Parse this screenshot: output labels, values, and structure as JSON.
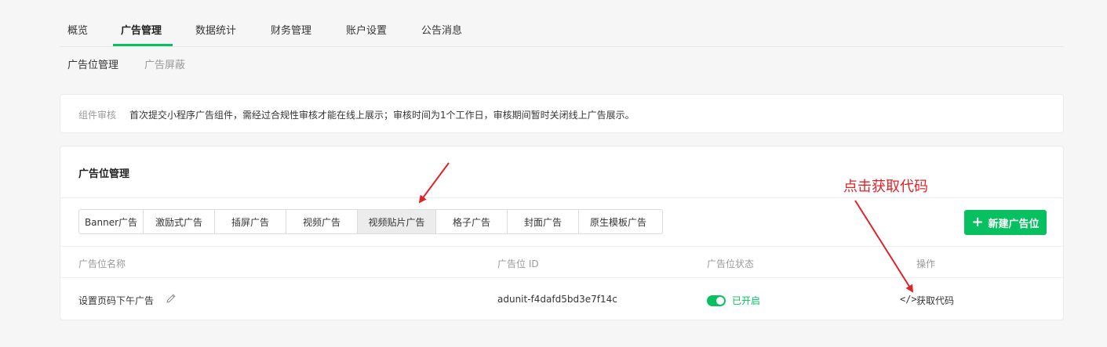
{
  "top_nav": {
    "tabs": [
      {
        "label": "概览"
      },
      {
        "label": "广告管理"
      },
      {
        "label": "数据统计"
      },
      {
        "label": "财务管理"
      },
      {
        "label": "账户设置"
      },
      {
        "label": "公告消息"
      }
    ],
    "active_index": 1
  },
  "sub_nav": {
    "tabs": [
      {
        "label": "广告位管理"
      },
      {
        "label": "广告屏蔽"
      }
    ],
    "active_index": 0
  },
  "notice": {
    "label": "组件审核",
    "text": "首次提交小程序广告组件，需经过合规性审核才能在线上展示；审核时间为1个工作日，审核期间暂时关闭线上广告展示。"
  },
  "panel": {
    "title": "广告位管理",
    "type_tabs": [
      {
        "label": "Banner广告"
      },
      {
        "label": "激励式广告"
      },
      {
        "label": "插屏广告"
      },
      {
        "label": "视频广告"
      },
      {
        "label": "视频贴片广告"
      },
      {
        "label": "格子广告"
      },
      {
        "label": "封面广告"
      },
      {
        "label": "原生模板广告"
      }
    ],
    "selected_type_index": 4,
    "new_button": {
      "label": "新建广告位",
      "icon": "plus-icon"
    },
    "table": {
      "headers": [
        "广告位名称",
        "广告位 ID",
        "广告位状态",
        "操作"
      ],
      "rows": [
        {
          "name": "设置页码下午广告",
          "id": "adunit-f4dafd5bd3e7f14c",
          "status": "已开启",
          "status_on": true,
          "action_icon": "</>",
          "action_label": "获取代码"
        }
      ]
    }
  },
  "annotation": {
    "text": "点击获取代码",
    "color": "#e0232a"
  },
  "colors": {
    "accent": "#07c160",
    "annotation": "#e0232a"
  }
}
